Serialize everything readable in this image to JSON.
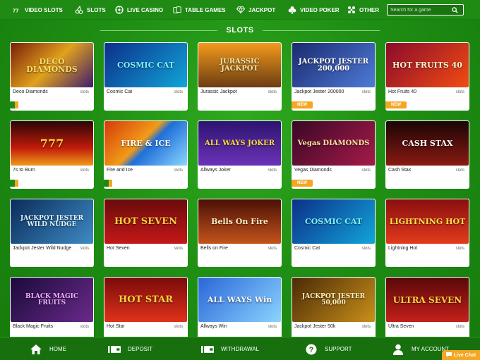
{
  "nav": {
    "items": [
      {
        "label": "VIDEO SLOTS",
        "icon": "777-icon"
      },
      {
        "label": "SLOTS",
        "icon": "cherries-icon"
      },
      {
        "label": "LIVE CASINO",
        "icon": "roulette-icon"
      },
      {
        "label": "TABLE GAMES",
        "icon": "cards-icon"
      },
      {
        "label": "JACKPOT",
        "icon": "diamond-icon"
      },
      {
        "label": "VIDEO POKER",
        "icon": "club-icon"
      },
      {
        "label": "OTHER",
        "icon": "dice-icon"
      }
    ],
    "search_placeholder": "Search for a game"
  },
  "section": {
    "title": "SLOTS"
  },
  "games": [
    {
      "name": "Deco Diamonds",
      "category": "slots",
      "badge": "flag",
      "art": "DECO DIAMONDS"
    },
    {
      "name": "Cosmic Cat",
      "category": "slots",
      "badge": "",
      "art": "COSMIC CAT"
    },
    {
      "name": "Jurassic Jackpot",
      "category": "slots",
      "badge": "",
      "art": "JURASSIC JACKPOT"
    },
    {
      "name": "Jackpot Jester 200000",
      "category": "slots",
      "badge": "NEW",
      "art": "JACKPOT JESTER 200,000"
    },
    {
      "name": "Hot Fruits 40",
      "category": "slots",
      "badge": "NEW",
      "art": "HOT FRUITS 40"
    },
    {
      "name": "7s to Burn",
      "category": "slots",
      "badge": "flag",
      "art": "777"
    },
    {
      "name": "Fire and Ice",
      "category": "slots",
      "badge": "flag",
      "art": "FIRE & ICE"
    },
    {
      "name": "Allways Joker",
      "category": "slots",
      "badge": "",
      "art": "ALL WAYS JOKER"
    },
    {
      "name": "Vegas Diamonds",
      "category": "slots",
      "badge": "NEW",
      "art": "Vegas DIAMONDS"
    },
    {
      "name": "Cash Stax",
      "category": "slots",
      "badge": "",
      "art": "CASH STAX"
    },
    {
      "name": "Jackpot Jester Wild Nudge",
      "category": "slots",
      "badge": "",
      "art": "JACKPOT JESTER WILD NUDGE"
    },
    {
      "name": "Hot Seven",
      "category": "slots",
      "badge": "",
      "art": "HOT SEVEN"
    },
    {
      "name": "Bells on Fire",
      "category": "slots",
      "badge": "",
      "art": "Bells On Fire"
    },
    {
      "name": "Cosmic Cat",
      "category": "slots",
      "badge": "",
      "art": "COSMIC CAT"
    },
    {
      "name": "Lightning Hot",
      "category": "slots",
      "badge": "",
      "art": "LIGHTNING HOT"
    },
    {
      "name": "Black Magic Fruits",
      "category": "slots",
      "badge": "",
      "art": "BLACK MAGIC FRUITS"
    },
    {
      "name": "Hot Star",
      "category": "slots",
      "badge": "",
      "art": "HOT STAR"
    },
    {
      "name": "Allways Win",
      "category": "slots",
      "badge": "",
      "art": "ALL WAYS Win"
    },
    {
      "name": "Jackpot Jester 50k",
      "category": "slots",
      "badge": "",
      "art": "JACKPOT JESTER 50,000"
    },
    {
      "name": "Ultra Seven",
      "category": "slots",
      "badge": "",
      "art": "ULTRA SEVEN"
    }
  ],
  "bottom": {
    "items": [
      {
        "label": "HOME",
        "icon": "home-icon"
      },
      {
        "label": "DEPOSIT",
        "icon": "wallet-icon"
      },
      {
        "label": "WITHDRAWAL",
        "icon": "wallet-icon"
      },
      {
        "label": "SUPPORT",
        "icon": "help-icon"
      },
      {
        "label": "MY ACCOUNT",
        "icon": "user-icon"
      }
    ],
    "live_chat": "Live Chat"
  },
  "colors": {
    "brand_green": "#1f8a14",
    "badge_orange": "#f5a623"
  }
}
